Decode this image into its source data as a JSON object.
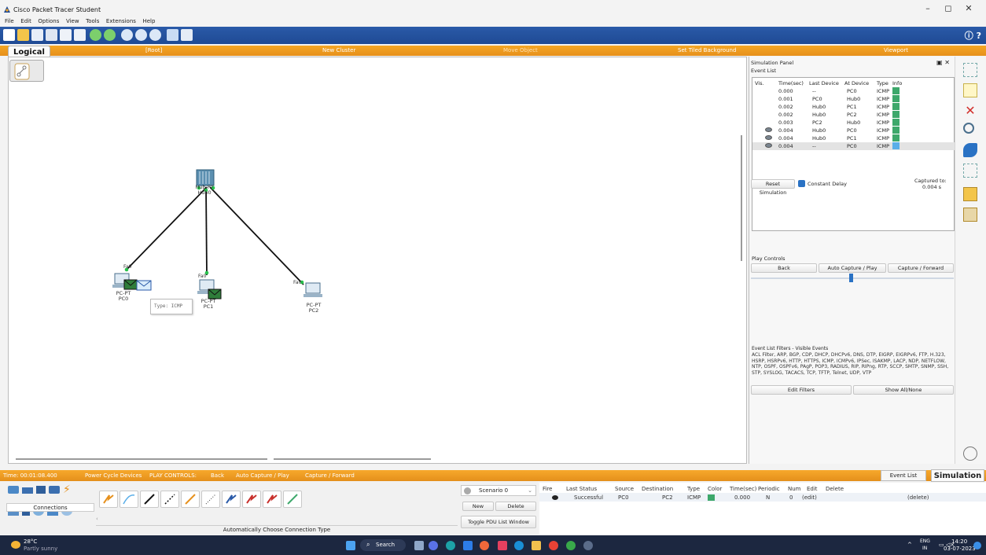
{
  "window": {
    "title": "Cisco Packet Tracer Student",
    "controls": [
      "–",
      "◻",
      "✕"
    ]
  },
  "menu": [
    "File",
    "Edit",
    "Options",
    "View",
    "Tools",
    "Extensions",
    "Help"
  ],
  "workspace_bar": {
    "logical_tab": "Logical",
    "root": "[Root]",
    "new_cluster": "New Cluster",
    "move_object": "Move Object",
    "set_tiled_background": "Set Tiled Background",
    "viewport": "Viewport"
  },
  "canvas": {
    "devices": [
      {
        "id": "hub0",
        "type_label": "Hub-PT",
        "name": "Hub0"
      },
      {
        "id": "pc0",
        "type_label": "PC-PT",
        "name": "PC0",
        "port": "Fa0"
      },
      {
        "id": "pc1",
        "type_label": "PC-PT",
        "name": "PC1",
        "port": "Fa0"
      },
      {
        "id": "pc2",
        "type_label": "PC-PT",
        "name": "PC2",
        "port": "Fa0"
      }
    ],
    "tooltip": "Type: ICMP"
  },
  "sim_panel": {
    "title": "Simulation Panel",
    "event_list_label": "Event List",
    "headers": [
      "Vis.",
      "Time(sec)",
      "Last Device",
      "At Device",
      "Type",
      "Info"
    ],
    "events": [
      {
        "vis": false,
        "time": "0.000",
        "last": "--",
        "at": "PC0",
        "type": "ICMP",
        "color": "#3da86b"
      },
      {
        "vis": false,
        "time": "0.001",
        "last": "PC0",
        "at": "Hub0",
        "type": "ICMP",
        "color": "#3da86b"
      },
      {
        "vis": false,
        "time": "0.002",
        "last": "Hub0",
        "at": "PC1",
        "type": "ICMP",
        "color": "#3da86b"
      },
      {
        "vis": false,
        "time": "0.002",
        "last": "Hub0",
        "at": "PC2",
        "type": "ICMP",
        "color": "#3da86b"
      },
      {
        "vis": false,
        "time": "0.003",
        "last": "PC2",
        "at": "Hub0",
        "type": "ICMP",
        "color": "#3da86b"
      },
      {
        "vis": true,
        "time": "0.004",
        "last": "Hub0",
        "at": "PC0",
        "type": "ICMP",
        "color": "#3da86b"
      },
      {
        "vis": true,
        "time": "0.004",
        "last": "Hub0",
        "at": "PC1",
        "type": "ICMP",
        "color": "#3da86b"
      },
      {
        "vis": true,
        "time": "0.004",
        "last": "--",
        "at": "PC0",
        "type": "ICMP",
        "color": "#5aaee8",
        "selected": true
      }
    ],
    "reset_simulation": "Reset Simulation",
    "constant_delay": "Constant Delay",
    "captured_to_label": "Captured to:",
    "captured_to_value": "0.004 s",
    "play_controls_label": "Play Controls",
    "back": "Back",
    "auto_capture": "Auto Capture / Play",
    "capture_forward": "Capture / Forward",
    "filters_label": "Event List Filters - Visible Events",
    "filters_text": "ACL Filter, ARP, BGP, CDP, DHCP, DHCPv6, DNS, DTP, EIGRP, EIGRPv6, FTP, H.323, HSRP, HSRPv6, HTTP, HTTPS, ICMP, ICMPv6, IPSec, ISAKMP, LACP, NDP, NETFLOW, NTP, OSPF, OSPFv6, PAgP, POP3, RADIUS, RIP, RIPng, RTP, SCCP, SMTP, SNMP, SSH, STP, SYSLOG, TACACS, TCP, TFTP, Telnet, UDP, VTP",
    "edit_filters": "Edit Filters",
    "show_all": "Show All/None"
  },
  "status_bar": {
    "time": "Time: 00:01:08.400",
    "power_cycle": "Power Cycle Devices",
    "play_controls": "PLAY CONTROLS:",
    "back": "Back",
    "auto_capture": "Auto Capture / Play",
    "capture_forward": "Capture / Forward",
    "event_list": "Event List",
    "simulation": "Simulation"
  },
  "bottom": {
    "connections": "Connections",
    "auto_connection": "Automatically Choose Connection Type",
    "scenario": "Scenario 0",
    "new": "New",
    "delete": "Delete",
    "toggle_pdu": "Toggle PDU List Window",
    "pdu_headers": [
      "Fire",
      "Last Status",
      "Source",
      "Destination",
      "Type",
      "Color",
      "Time(sec)",
      "Periodic",
      "Num",
      "Edit",
      "Delete"
    ],
    "pdu_row": {
      "status": "Successful",
      "source": "PC0",
      "destination": "PC2",
      "type": "ICMP",
      "color": "#3da86b",
      "time": "0.000",
      "periodic": "N",
      "num": "0",
      "edit": "(edit)",
      "delete": "(delete)"
    }
  },
  "taskbar": {
    "temp": "28°C",
    "weather": "Partly sunny",
    "search": "Search",
    "lang_top": "ENG",
    "lang_bottom": "IN",
    "time": "14:20",
    "date": "03-07-2023"
  }
}
